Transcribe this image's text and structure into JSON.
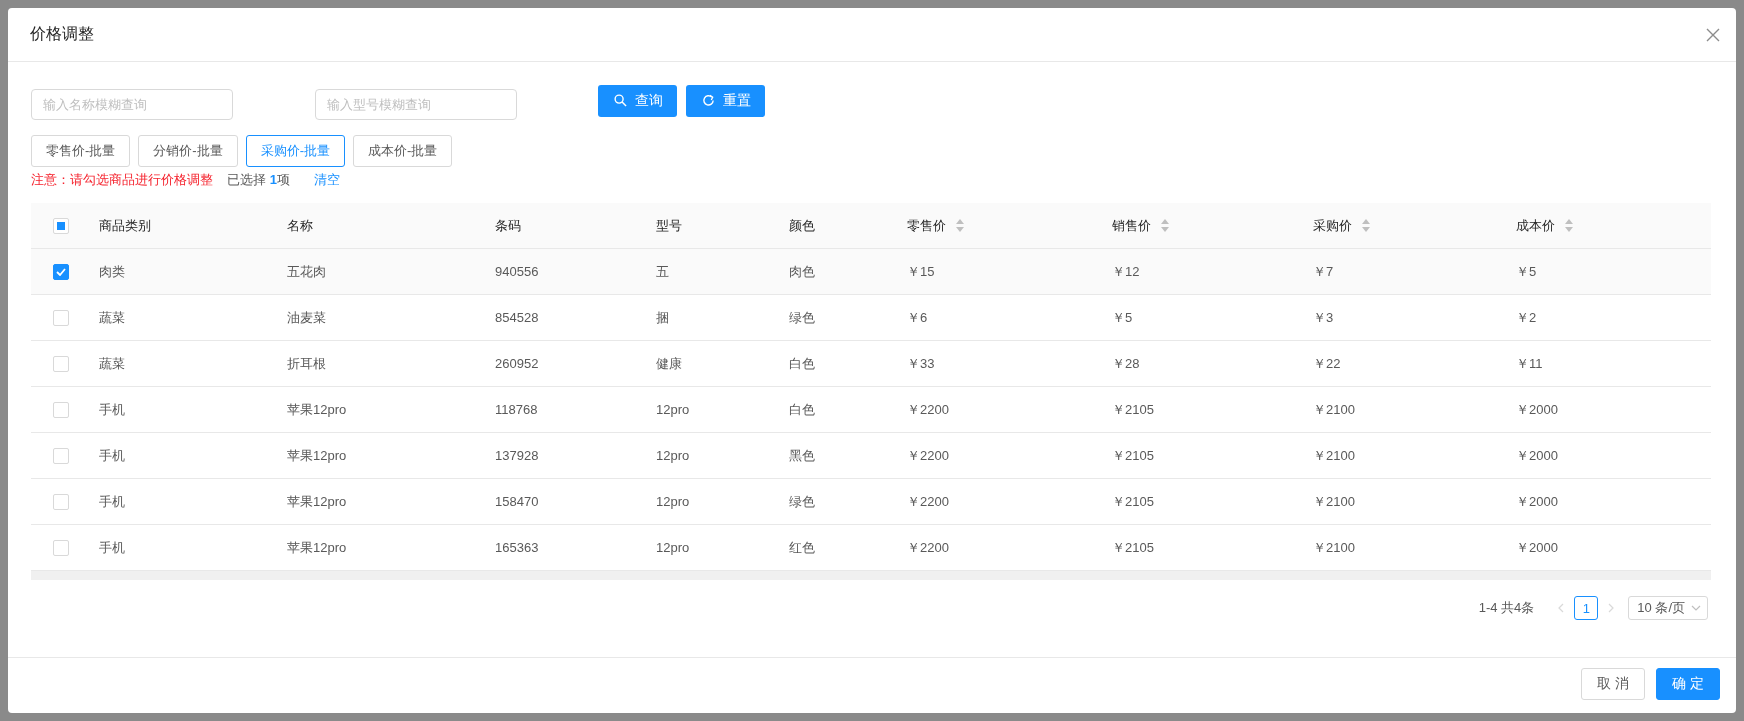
{
  "dialog": {
    "title": "价格调整"
  },
  "filters": [
    {
      "placeholder": "输入名称模糊查询"
    },
    {
      "placeholder": "输入型号模糊查询"
    }
  ],
  "actions": [
    {
      "kind": "search",
      "label": "查询"
    },
    {
      "kind": "reset",
      "label": "重置"
    }
  ],
  "batch_buttons": [
    {
      "label": "零售价-批量",
      "selected": false
    },
    {
      "label": "分销价-批量",
      "selected": false
    },
    {
      "label": "采购价-批量",
      "selected": true
    },
    {
      "label": "成本价-批量",
      "selected": false
    }
  ],
  "notice": {
    "warning": "注意：请勾选商品进行价格调整",
    "selected_prefix": "已选择",
    "selected_count": "1",
    "selected_suffix": "项",
    "clear_link": "清空"
  },
  "table": {
    "select_all": {
      "indeterminate": true
    },
    "columns": [
      {
        "label": "商品类别",
        "sortable": false
      },
      {
        "label": "名称",
        "sortable": false
      },
      {
        "label": "条码",
        "sortable": false
      },
      {
        "label": "型号",
        "sortable": false
      },
      {
        "label": "颜色",
        "sortable": false
      },
      {
        "label": "零售价",
        "sortable": true
      },
      {
        "label": "销售价",
        "sortable": true
      },
      {
        "label": "采购价",
        "sortable": true
      },
      {
        "label": "成本价",
        "sortable": true
      }
    ],
    "rows": [
      {
        "selected": true,
        "cells": [
          "肉类",
          "五花肉",
          "940556",
          "五",
          "肉色",
          "￥15",
          "￥12",
          "￥7",
          "￥5"
        ]
      },
      {
        "selected": false,
        "cells": [
          "蔬菜",
          "油麦菜",
          "854528",
          "捆",
          "绿色",
          "￥6",
          "￥5",
          "￥3",
          "￥2"
        ]
      },
      {
        "selected": false,
        "cells": [
          "蔬菜",
          "折耳根",
          "260952",
          "健康",
          "白色",
          "￥33",
          "￥28",
          "￥22",
          "￥11"
        ]
      },
      {
        "selected": false,
        "cells": [
          "手机",
          "苹果12pro",
          "118768",
          "12pro",
          "白色",
          "￥2200",
          "￥2105",
          "￥2100",
          "￥2000"
        ]
      },
      {
        "selected": false,
        "cells": [
          "手机",
          "苹果12pro",
          "137928",
          "12pro",
          "黑色",
          "￥2200",
          "￥2105",
          "￥2100",
          "￥2000"
        ]
      },
      {
        "selected": false,
        "cells": [
          "手机",
          "苹果12pro",
          "158470",
          "12pro",
          "绿色",
          "￥2200",
          "￥2105",
          "￥2100",
          "￥2000"
        ]
      },
      {
        "selected": false,
        "cells": [
          "手机",
          "苹果12pro",
          "165363",
          "12pro",
          "红色",
          "￥2200",
          "￥2105",
          "￥2100",
          "￥2000"
        ]
      }
    ]
  },
  "pagination": {
    "total": "1-4 共4条",
    "pages": [
      {
        "label": "1",
        "selected": true
      }
    ],
    "prev_disabled": true,
    "next_disabled": true,
    "page_size": "10 条/页"
  },
  "footer": {
    "buttons": [
      {
        "kind": "default",
        "label": "取 消"
      },
      {
        "kind": "primary",
        "label": "确 定"
      }
    ]
  }
}
